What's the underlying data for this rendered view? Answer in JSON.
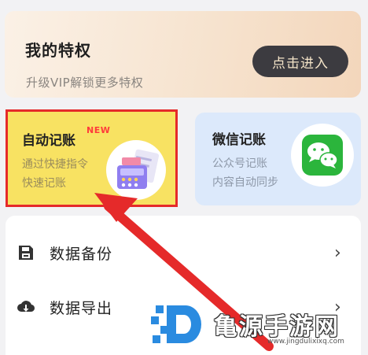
{
  "vip": {
    "title": "我的特权",
    "subtitle": "升级VIP解锁更多特权",
    "button_label": "点击进入"
  },
  "auto_card": {
    "title": "自动记账",
    "badge": "NEW",
    "line1": "通过快捷指令",
    "line2": "快速记账",
    "icon": "cash-register-icon"
  },
  "wechat_card": {
    "title": "微信记账",
    "line1": "公众号记账",
    "line2": "内容自动同步",
    "icon": "wechat-icon"
  },
  "list": {
    "items": [
      {
        "label": "数据备份",
        "icon": "backup-icon"
      },
      {
        "label": "数据导出",
        "icon": "cloud-download-icon"
      }
    ]
  },
  "watermark": {
    "text": "亀源手游网",
    "url": "www.jingdulixixq.com"
  },
  "colors": {
    "highlight": "#e52a2a",
    "auto_card_bg": "#f8e262",
    "wechat_card_bg": "#dce9fb",
    "wechat_green": "#2bb53c",
    "vip_button_bg": "#3c3b40"
  }
}
